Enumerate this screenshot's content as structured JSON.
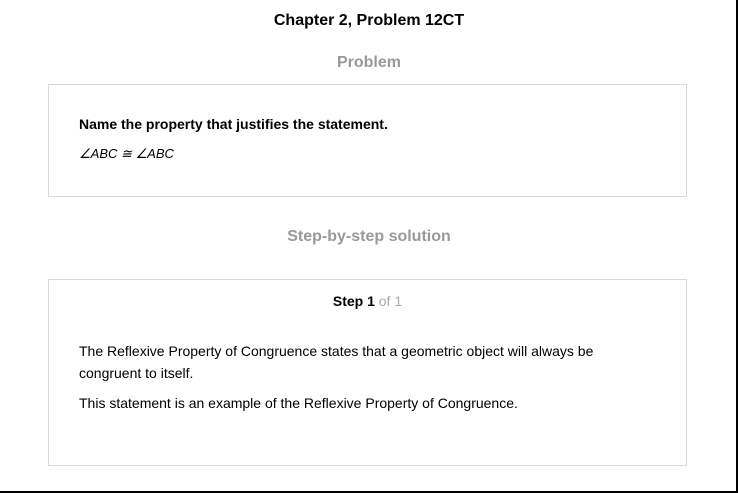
{
  "page": {
    "title": "Chapter 2, Problem 12CT"
  },
  "problem": {
    "heading": "Problem",
    "prompt": "Name the property that justifies the statement.",
    "statement": "∠ABC ≅ ∠ABC"
  },
  "solution": {
    "heading": "Step-by-step solution",
    "step_label": "Step 1",
    "step_of": " of 1",
    "paragraphs": [
      "The Reflexive Property of Congruence states that a geometric object will always be congruent to itself.",
      "This statement is an example of the Reflexive Property of Congruence."
    ]
  },
  "colors": {
    "heading_gray": "#999999",
    "border": "#d9d9d9",
    "step_of_gray": "#aaaaaa"
  }
}
